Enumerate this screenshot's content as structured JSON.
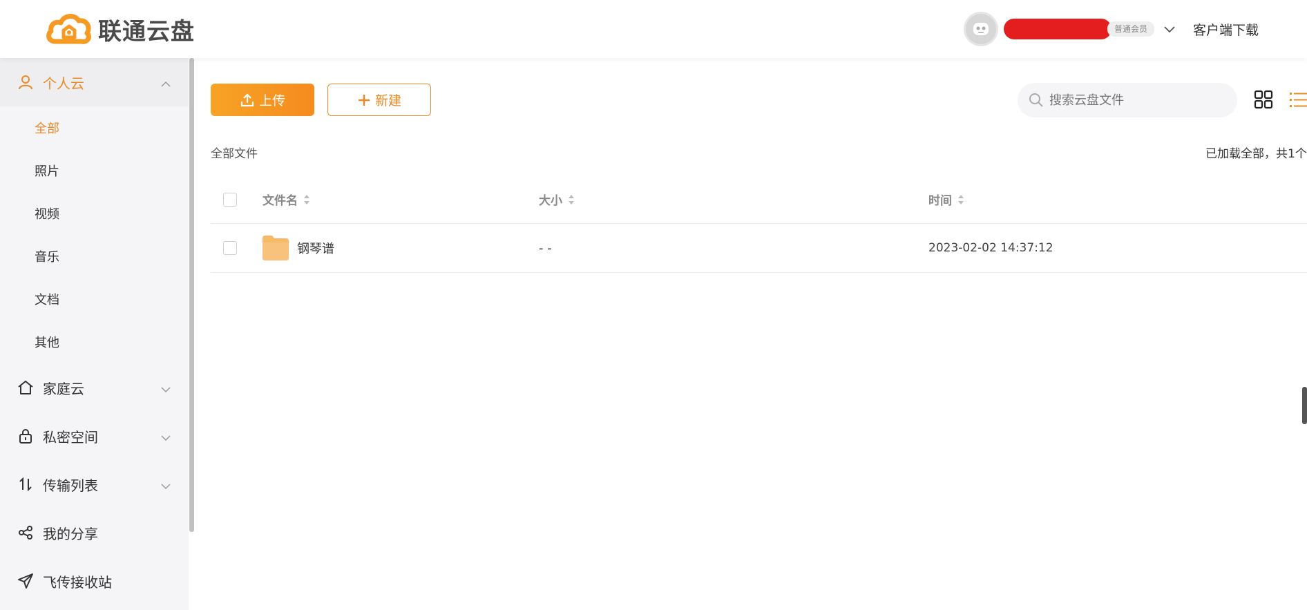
{
  "header": {
    "logo_text": "联通云盘",
    "member_badge": "普通会员",
    "download_label": "客户端下载"
  },
  "sidebar": {
    "personal": {
      "label": "个人云",
      "items": [
        {
          "label": "全部"
        },
        {
          "label": "照片"
        },
        {
          "label": "视频"
        },
        {
          "label": "音乐"
        },
        {
          "label": "文档"
        },
        {
          "label": "其他"
        }
      ]
    },
    "family": {
      "label": "家庭云"
    },
    "private": {
      "label": "私密空间"
    },
    "transfer": {
      "label": "传输列表"
    },
    "share": {
      "label": "我的分享"
    },
    "flytransfer": {
      "label": "飞传接收站"
    }
  },
  "toolbar": {
    "upload_label": "上传",
    "new_label": "新建",
    "search_placeholder": "搜索云盘文件"
  },
  "breadcrumb": "全部文件",
  "load_status": "已加载全部，共1个",
  "table": {
    "columns": {
      "name": "文件名",
      "size": "大小",
      "time": "时间"
    },
    "rows": [
      {
        "name": "钢琴谱",
        "size": "- -",
        "time": "2023-02-02 14:37:12"
      }
    ]
  },
  "colors": {
    "accent": "#e98a27",
    "sidebar_bg": "#f5f5f7",
    "redaction": "#e41e1e"
  }
}
